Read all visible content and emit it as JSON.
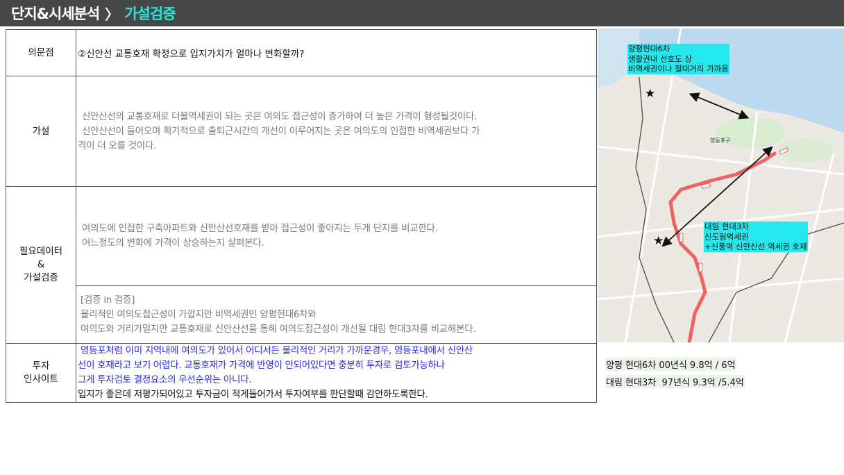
{
  "header": {
    "title_main": "단지&시세분석",
    "separator": "〉",
    "title_sub": "가설검증"
  },
  "table": {
    "q_label": "의문점",
    "q_text": "②신안선 교통호재 확정으로 입지가치가  얼마나 변화할까?",
    "h_label": "가설",
    "h_lines": [
      "신안산선의 교통호재로 더블역세권이 되는 곳은 여의도 접근성이 증가하여 더 높은 가격이 형성될것이다.",
      "신안산선이 들어오며 획기적으로 출퇴근시간의 개선이 이루어지는 곳은 여의도의 인접한 비역세권보다 가",
      "격이 더 오를 것이다."
    ],
    "d_label_1": "필요데이터",
    "d_label_2": "&",
    "d_label_3": "가설검증",
    "d1_lines": [
      "여의도에 인접한 구축아파트와 신안산선호재를 받아 접근성이 좋아지는 두개 단지를 비교한다.",
      "어느정도의 변화에 가격이 상승하는지 살펴본다."
    ],
    "d2_lines": [
      "[검증 in 검증]",
      "물리적인 여의도접근성이  가깝지만 비역세권인 양평현대6차와",
      "여의도와 거리가멀지만 교통호재로 신안산선을 통해 여의도접근성이 개선될 대림 현대3차를 비교해본다."
    ],
    "i_label_1": "투자",
    "i_label_2": "인사이트",
    "i_blue_lines": [
      " 영등포처럼 이미 지역내에 여의도가 있어서 어디서든 물리적인 거리가 가까운경우, 영등포내에서 신안산",
      "선이 호재라고 보기 어렵다. 교통호재가 가격에 반영이 안되어있다면 충분히 투자로 검토가능하나",
      "그게 투자검토 결정요소의 우선순위는 아니다."
    ],
    "i_black_line": "입지가 좋은데 저평가되어있고 투자금이 적게들어가서 투자여부를 판단할때 감안하도록한다."
  },
  "map": {
    "callout_top": [
      "양평현대6차",
      "생활권내 선호도 상",
      "비역세권이나 절대거리 가까움"
    ],
    "callout_mid": [
      "대림 현대3차",
      "신도림역세권",
      "+신풍역 신안산선 역세권 호재"
    ],
    "district_label": "영등포구",
    "line_color": "#f06262",
    "callout_color": "#24e8ec"
  },
  "notes": {
    "line1": "양평 현대6차 00년식 9.8억 / 6억",
    "line2": "대림 현대3차  97년식 9.3억 /5.4억"
  }
}
